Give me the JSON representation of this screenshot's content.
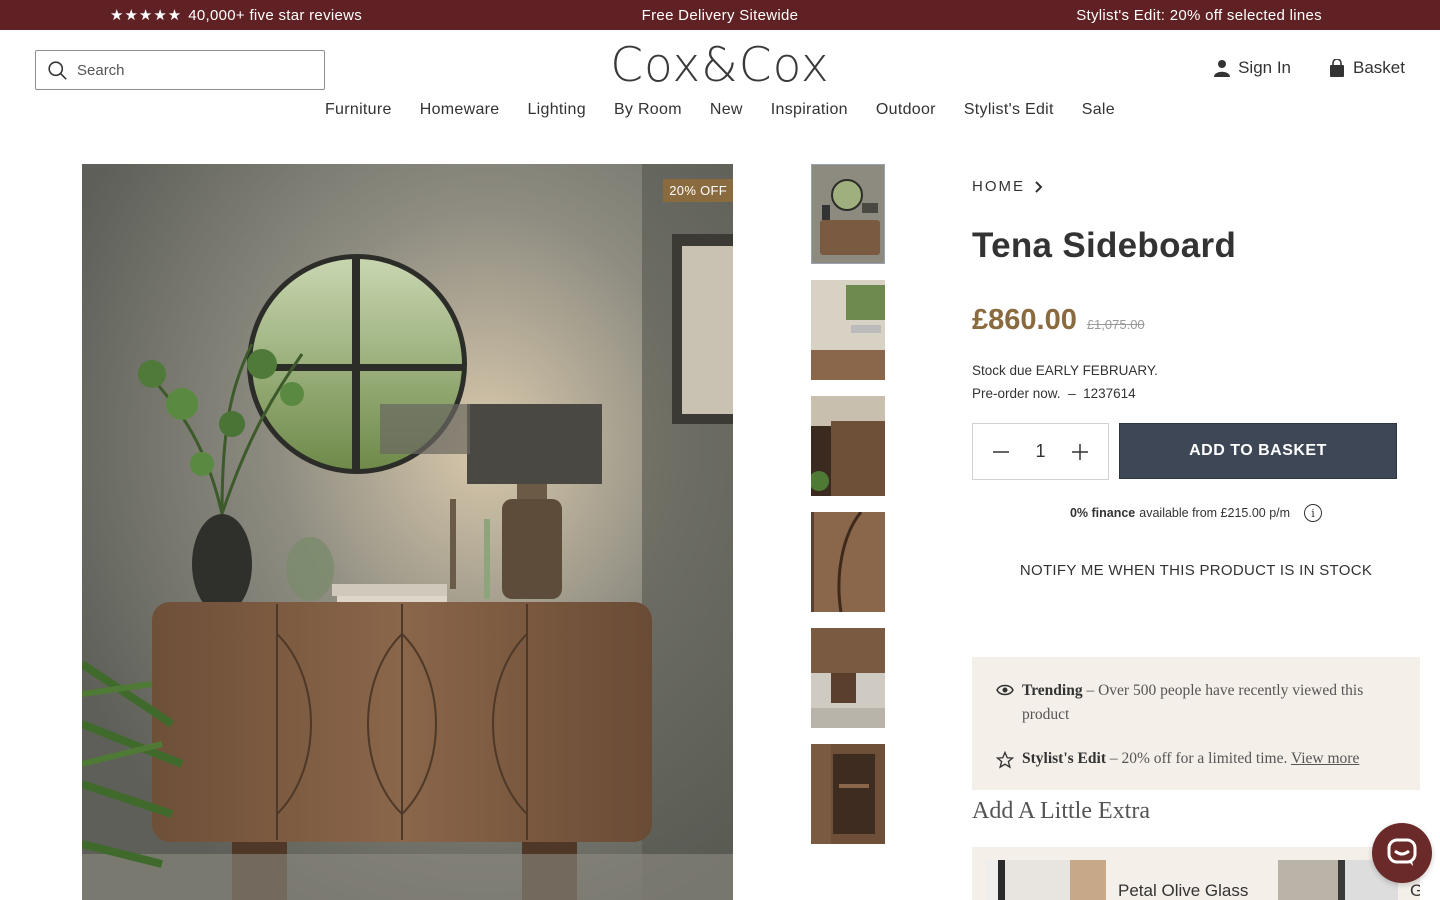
{
  "announcement": {
    "reviews_stars": "★★★★★",
    "reviews_text": "40,000+ five star reviews",
    "delivery": "Free Delivery Sitewide",
    "promo": "Stylist's Edit: 20% off selected lines"
  },
  "header": {
    "search_placeholder": "Search",
    "logo": "Cox&Cox",
    "sign_in": "Sign In",
    "basket": "Basket"
  },
  "nav": {
    "items": [
      "Furniture",
      "Homeware",
      "Lighting",
      "By Room",
      "New",
      "Inspiration",
      "Outdoor",
      "Stylist's Edit",
      "Sale"
    ]
  },
  "gallery": {
    "badge": "20% OFF",
    "thumbnail_count": 6
  },
  "product": {
    "breadcrumb": "HOME",
    "title": "Tena Sideboard",
    "price": "£860.00",
    "was_price": "£1,075.00",
    "stock_line": "Stock due EARLY FEBRUARY.",
    "preorder": "Pre-order now.",
    "separator": "–",
    "sku": "1237614",
    "quantity": "1",
    "add_to_basket": "ADD TO BASKET",
    "finance_bold": "0% finance",
    "finance_text": "available from £215.00 p/m",
    "notify": "NOTIFY ME WHEN THIS PRODUCT IS IN STOCK"
  },
  "promo": {
    "trending_label": "Trending",
    "trending_text": "– Over 500 people have recently viewed this product",
    "stylist_label": "Stylist's Edit",
    "stylist_text": "– 20% off for a limited time.",
    "stylist_link": "View more"
  },
  "extras": {
    "title": "Add A Little Extra",
    "item1": "Petal Olive Glass",
    "item2": "G"
  },
  "colors": {
    "announcement_bg": "#5f2123",
    "price": "#8a6a3f",
    "add_button": "#3d4756",
    "promo_bg": "#f4efe9"
  },
  "icons": [
    "search-icon",
    "user-icon",
    "basket-icon",
    "chevron-right-icon",
    "minus-icon",
    "plus-icon",
    "info-icon",
    "eye-icon",
    "star-icon",
    "chat-icon"
  ]
}
